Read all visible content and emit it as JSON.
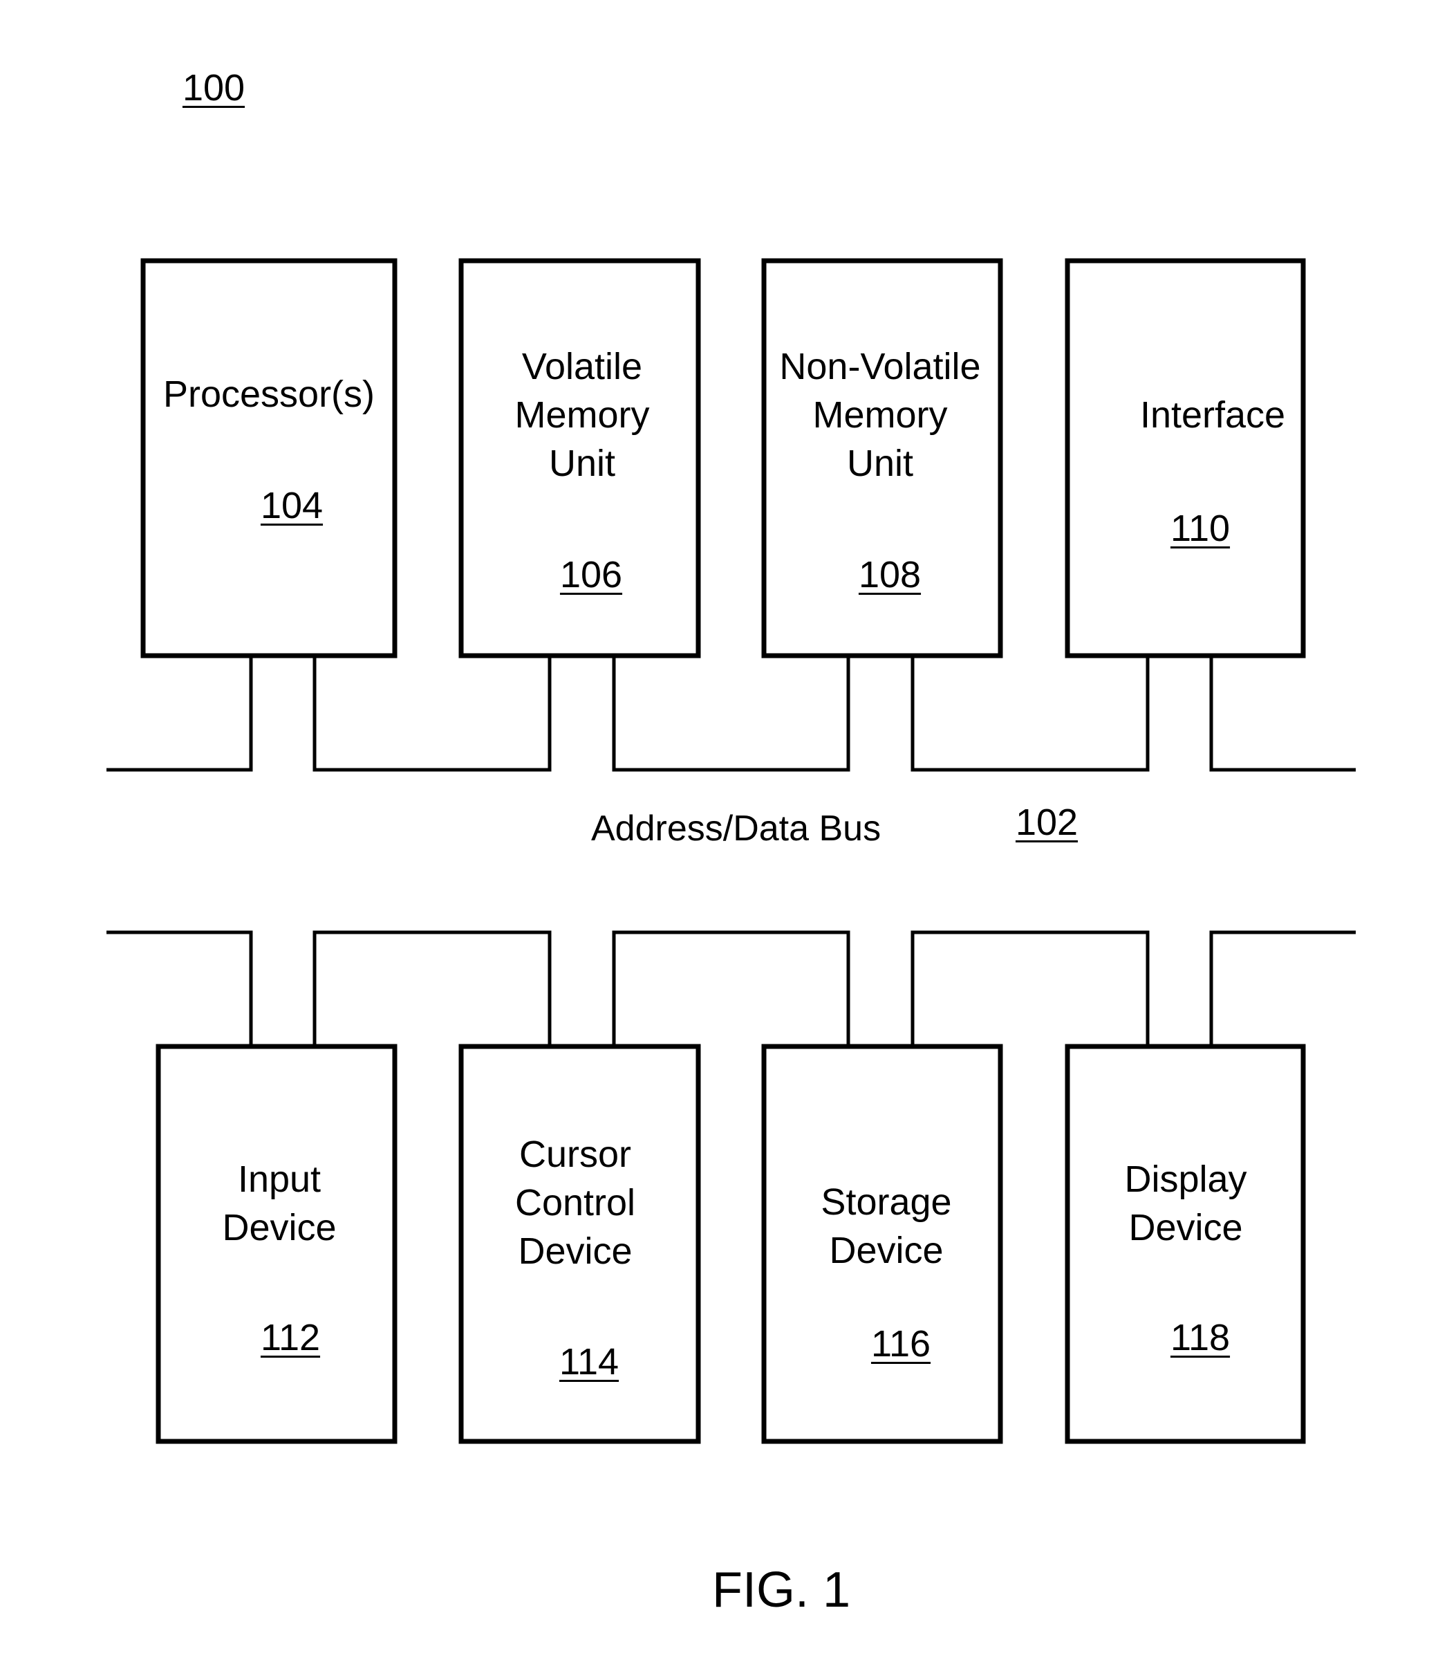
{
  "figure": {
    "ref": "100",
    "caption": "FIG. 1"
  },
  "bus": {
    "label": "Address/Data Bus",
    "ref": "102"
  },
  "top_components": [
    {
      "label": "Processor(s)",
      "ref": "104"
    },
    {
      "label": "Volatile\nMemory\nUnit",
      "ref": "106"
    },
    {
      "label": "Non-Volatile\nMemory\nUnit",
      "ref": "108"
    },
    {
      "label": "Interface",
      "ref": "110"
    }
  ],
  "bottom_components": [
    {
      "label": "Input\nDevice",
      "ref": "112"
    },
    {
      "label": "Cursor\nControl\nDevice",
      "ref": "114"
    },
    {
      "label": "Storage\nDevice",
      "ref": "116"
    },
    {
      "label": "Display\nDevice",
      "ref": "118"
    }
  ],
  "colors": {
    "line": "#000000",
    "background": "#ffffff"
  }
}
